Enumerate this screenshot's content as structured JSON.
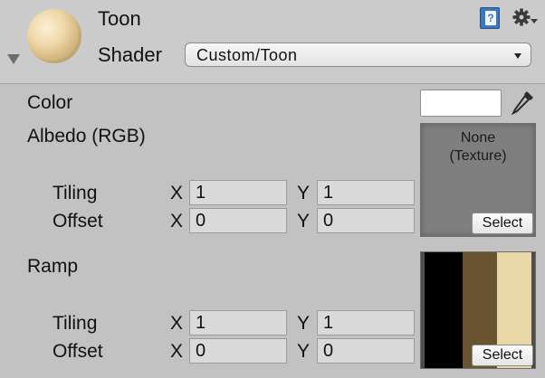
{
  "header": {
    "material_name": "Toon",
    "shader_label": "Shader",
    "shader_value": "Custom/Toon",
    "icons": [
      "help-book-icon",
      "gear-icon"
    ]
  },
  "properties": {
    "color_label": "Color",
    "color_value": "#ffffff",
    "albedo": {
      "label": "Albedo (RGB)",
      "texture_text_line1": "None",
      "texture_text_line2": "(Texture)",
      "select_label": "Select",
      "tiling_label": "Tiling",
      "offset_label": "Offset",
      "tiling_x": "1",
      "tiling_y": "1",
      "offset_x": "0",
      "offset_y": "0"
    },
    "ramp": {
      "label": "Ramp",
      "select_label": "Select",
      "tiling_label": "Tiling",
      "offset_label": "Offset",
      "tiling_x": "1",
      "tiling_y": "1",
      "offset_x": "0",
      "offset_y": "0",
      "ramp_colors": [
        "#000000",
        "#6a5330",
        "#e8d8a8"
      ]
    },
    "axis_x": "X",
    "axis_y": "Y"
  }
}
